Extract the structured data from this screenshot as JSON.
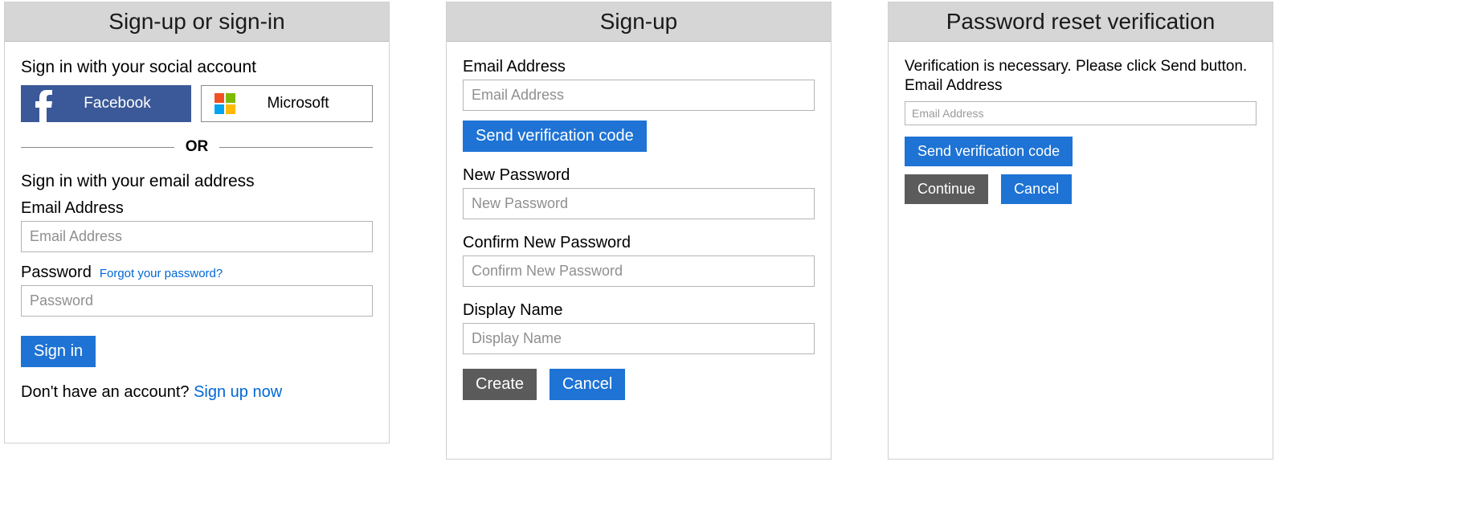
{
  "panel1": {
    "title": "Sign-up or sign-in",
    "social_heading": "Sign in with your social account",
    "facebook_label": "Facebook",
    "microsoft_label": "Microsoft",
    "divider": "OR",
    "local_heading": "Sign in with your email address",
    "email_label": "Email Address",
    "email_placeholder": "Email Address",
    "password_label": "Password",
    "forgot_link": "Forgot your password?",
    "password_placeholder": "Password",
    "signin_button": "Sign in",
    "no_account_text": "Don't have an account? ",
    "signup_link": "Sign up now"
  },
  "panel2": {
    "title": "Sign-up",
    "email_label": "Email Address",
    "email_placeholder": "Email Address",
    "send_code_button": "Send verification code",
    "new_password_label": "New Password",
    "new_password_placeholder": "New Password",
    "confirm_password_label": "Confirm New Password",
    "confirm_password_placeholder": "Confirm New Password",
    "display_name_label": "Display Name",
    "display_name_placeholder": "Display Name",
    "create_button": "Create",
    "cancel_button": "Cancel"
  },
  "panel3": {
    "title": "Password reset verification",
    "info_text": "Verification is necessary. Please click Send button.",
    "email_label": "Email Address",
    "email_placeholder": "Email Address",
    "send_code_button": "Send verification code",
    "continue_button": "Continue",
    "cancel_button": "Cancel"
  },
  "colors": {
    "primary": "#1e73d4",
    "secondary": "#5b5b5b",
    "facebook": "#3b5998",
    "ms_red": "#f25022",
    "ms_green": "#7fba00",
    "ms_blue": "#00a4ef",
    "ms_yellow": "#ffb900"
  }
}
